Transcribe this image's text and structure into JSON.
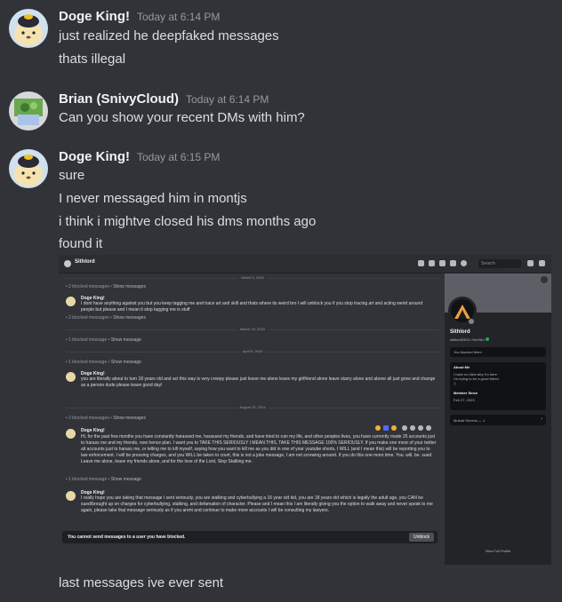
{
  "messages": [
    {
      "author": "Doge King!",
      "timestamp": "Today at 6:14 PM",
      "avatar_icon": "doge-avatar",
      "lines": [
        "just realized he deepfaked messages",
        "thats illegal"
      ]
    },
    {
      "author": "Brian (SnivyCloud)",
      "timestamp": "Today at 6:14 PM",
      "avatar_icon": "snivy-avatar",
      "lines": [
        "Can you show your recent DMs with him?"
      ]
    },
    {
      "author": "Doge King!",
      "timestamp": "Today at 6:15 PM",
      "avatar_icon": "doge-avatar",
      "lines": [
        "sure",
        "I never messaged him in montjs",
        "i think i mightve closed his dms months ago",
        "found it"
      ]
    }
  ],
  "screenshot": {
    "channel_name": "Sithlord",
    "search_placeholder": "Search",
    "dates": [
      "March 5, 2024",
      "March 19, 2024",
      "April 6, 2024",
      "August 15, 2024"
    ],
    "blocked": [
      {
        "count": "2 blocked messages",
        "action": "Show messages"
      },
      {
        "count": "2 blocked messages",
        "action": "Show messages"
      },
      {
        "count": "1 blocked message",
        "action": "Show message"
      },
      {
        "count": "1 blocked message",
        "action": "Show message"
      },
      {
        "count": "2 blocked messages",
        "action": "Show messages"
      },
      {
        "count": "1 blocked message",
        "action": "Show message"
      }
    ],
    "posts": [
      {
        "author": "Doge King!",
        "time": "",
        "text": "I dont have anything against you but you keep tagging me and trace art and skill and thats where its weird bro I will unblock you if you stop tracing art and acting weird around people but please and I mean it stop tagging me is stuff"
      },
      {
        "author": "Doge King!",
        "time": "",
        "text": "you are literally about to turn 18 years old and act this way is very creepy please just leave me alone leave my girlfriend alone leave starry alone and above all just grow and change as a person dude please leave good day!"
      },
      {
        "author": "Doge King!",
        "time": "",
        "text": "Hi, for the past few months you have constantly harassed me, harassed my friends, and have tried to ruin my life, and other peoples lives, you have currently made 25 accounts just to harass me and my friends, now hence plan. I want you to TAKE THIS SERIOUSLY I MEAN THIS, TAKE THIS MESSAGE 100% SERIOUSLY. If you make one more of your twitter alt accounts just to harass me, or telling me to kill myself, saying how you want to kill me as you did in one of your youtube shorts, I WILL (and I mean this) will be reporting you to law enforcement. I will be pressing charges, and you WILL be taken to court, this is not a joke message, I am not screwing around. If you do this one more time. You. will. be. sued. Leave me alone, leave my friends alone, and for the love of the Lord, Stop Stalking me."
      },
      {
        "author": "Doge King!",
        "time": "",
        "text": "I really hope you are taking that message I sent seriously, you are stalking and cyberbullying a 16 year old kid, you are 18 years old which is legally the adult age, you CAN be sued/brought up on charges for cyberbullying, stalking, and defamation of character. Please and I mean this I am literally giving you the option to walk away and never speak to me again, please take that message seriously as if you arent and continue to make more accounts I will be consulting my lawyers."
      }
    ],
    "cannot_send": "You cannot send messages to a user you have blocked.",
    "unblock_label": "Unblock",
    "profile": {
      "name": "Sithlord",
      "tag": "sithlord2903 • He/Him",
      "blocked_note": "You blocked them",
      "about_heading": "About Me",
      "about_lines": [
        "I have no idea why I'm here",
        "I'm trying to be a good friend",
        ":)"
      ],
      "member_since_heading": "Member Since",
      "member_since": "Feb 27, 2023",
      "mutual_servers": "Mutual Servers — 1",
      "view_full": "View Full Profile"
    }
  },
  "caption": "last messages ive ever sent"
}
